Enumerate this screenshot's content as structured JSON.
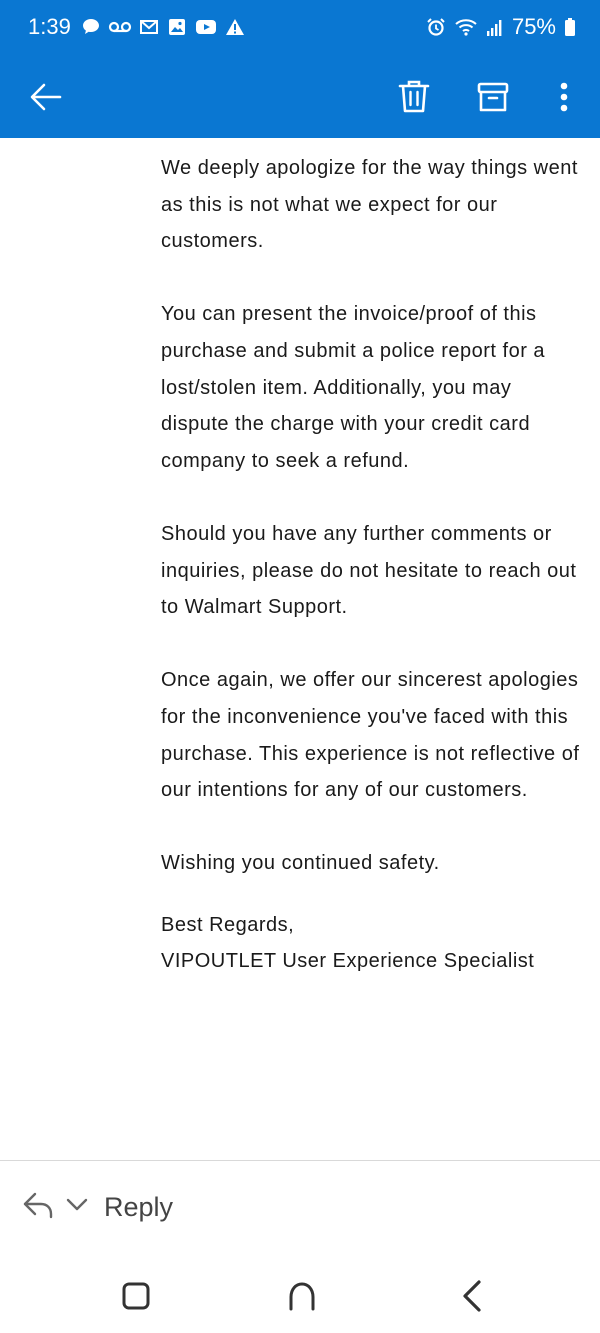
{
  "status_bar": {
    "time": "1:39",
    "battery": "75%",
    "left_icons": [
      "chat-bubble-icon",
      "voicemail-icon",
      "gmail-icon",
      "photo-icon",
      "youtube-icon",
      "warning-icon"
    ],
    "right_icons": [
      "alarm-icon",
      "wifi-icon",
      "signal-icon",
      "battery-icon"
    ]
  },
  "app_bar": {
    "color": "#0a77d2",
    "icons": [
      "back-arrow-icon",
      "trash-icon",
      "archive-icon",
      "more-vert-icon"
    ]
  },
  "email": {
    "paragraphs": [
      "We deeply apologize for the way things went as this is not what we expect for our customers.",
      "You can present the invoice/proof of this purchase and submit a police report for a lost/stolen item. Additionally, you may dispute the charge with your credit card company to seek a refund.",
      "Should you have any further comments or inquiries, please do not hesitate to reach out to Walmart Support.",
      "Once again, we offer our sincerest apologies for the inconvenience you've faced with this purchase. This experience is not reflective of our intentions for any of our customers.",
      "Wishing you continued safety."
    ],
    "closing": "Best Regards,",
    "signature": "VIPOUTLET User Experience Specialist"
  },
  "reply_bar": {
    "label": "Reply",
    "icons": [
      "reply-arrow-icon",
      "chevron-down-icon"
    ]
  },
  "nav_bar": {
    "icons": [
      "recents-icon",
      "home-icon",
      "nav-back-icon"
    ]
  }
}
